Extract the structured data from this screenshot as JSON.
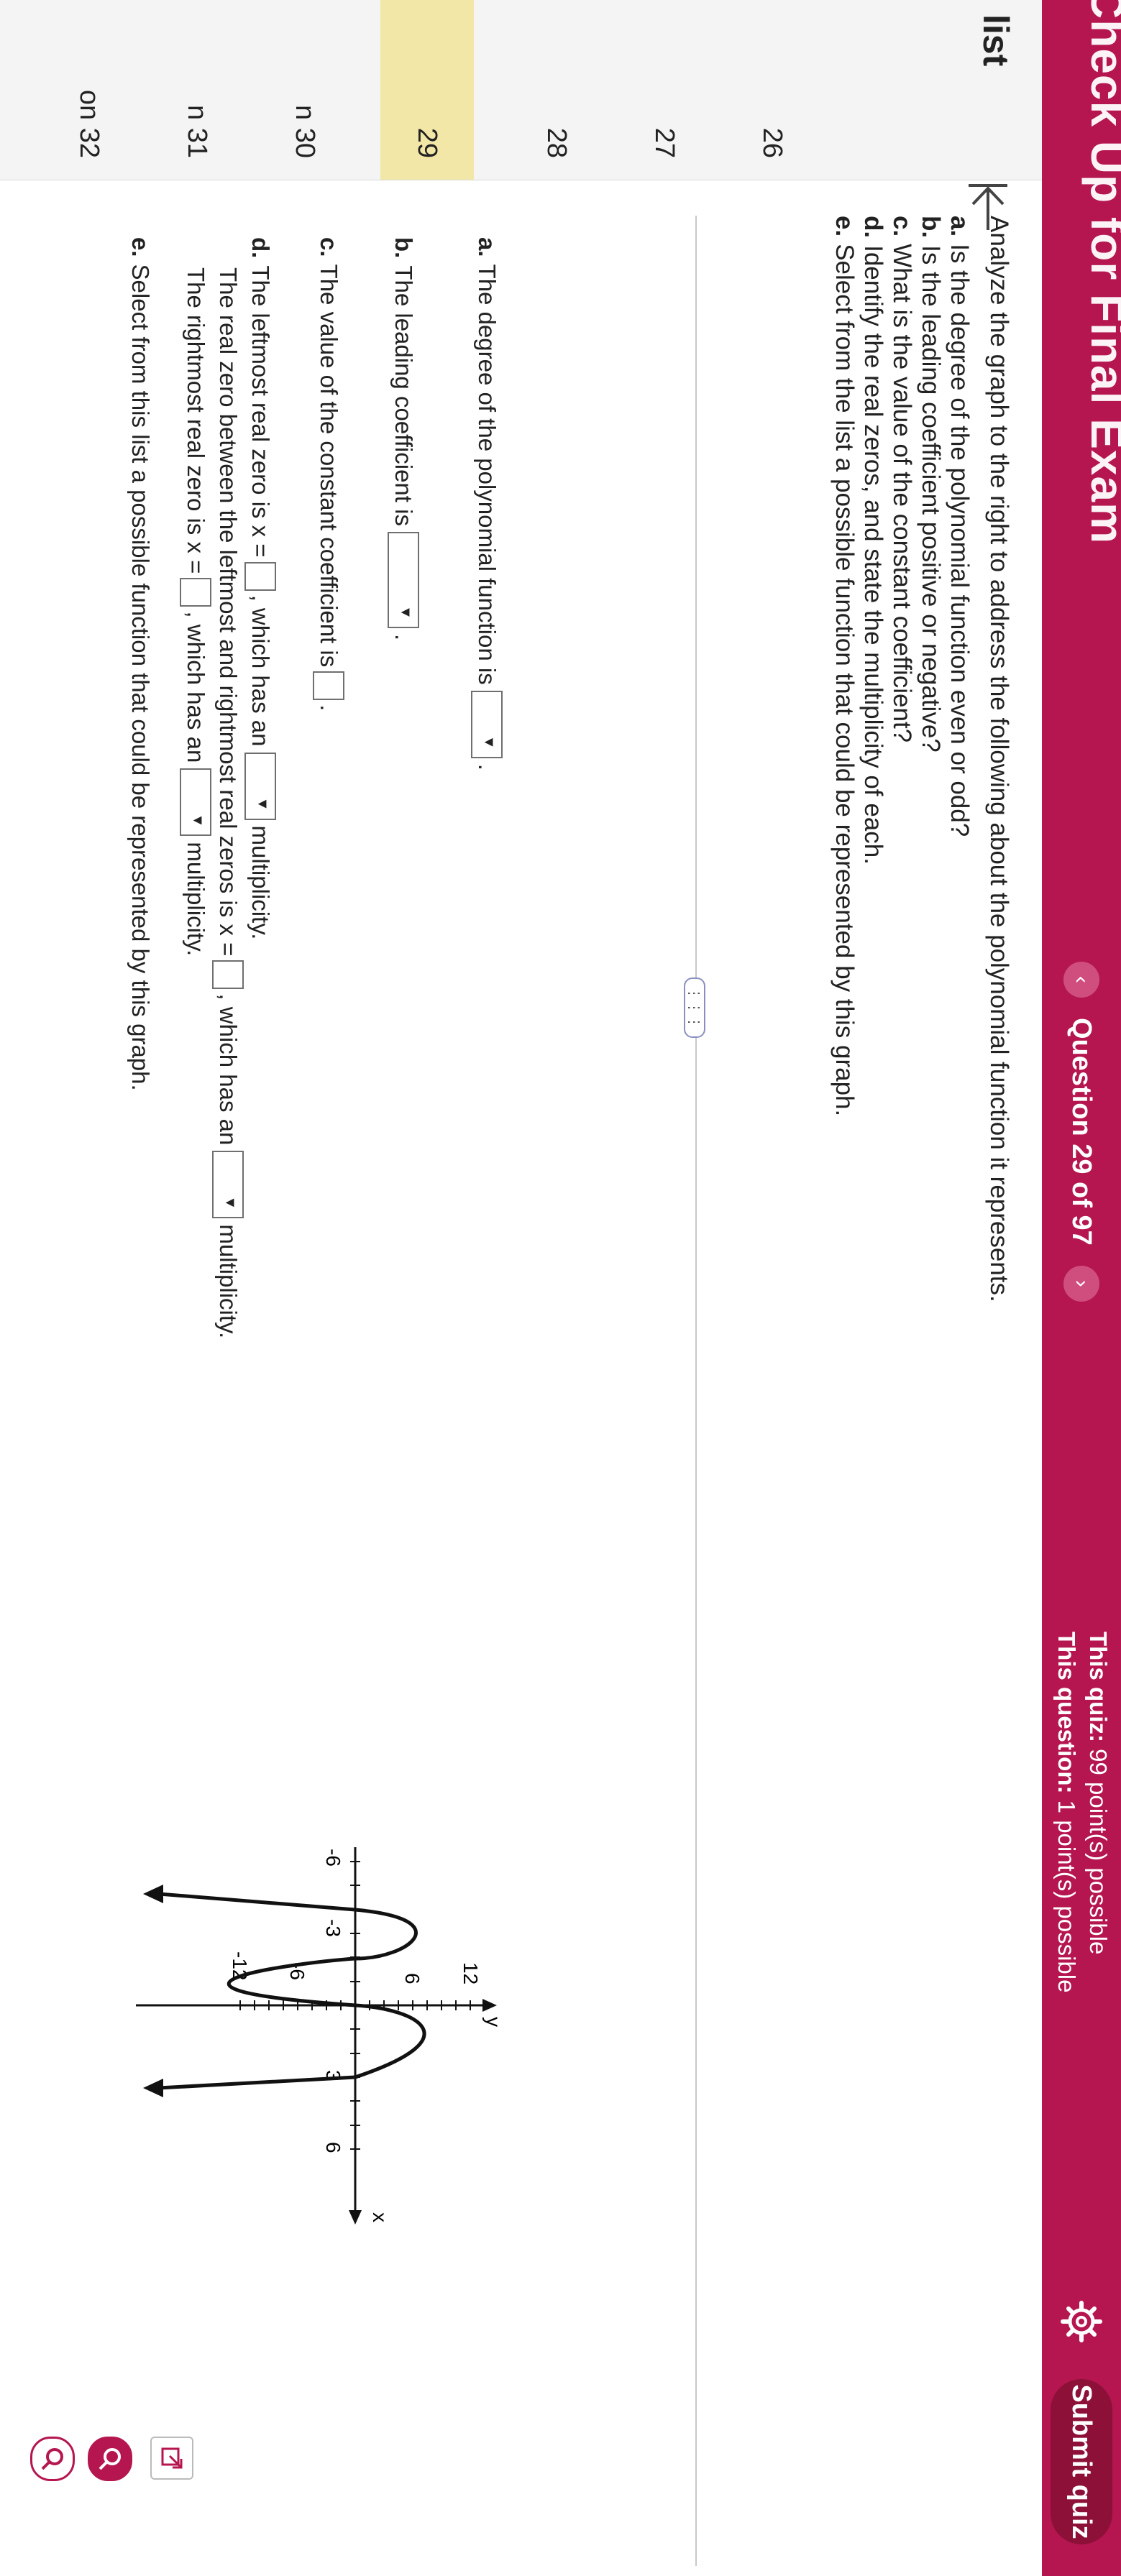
{
  "header": {
    "quiz_title": "Check Up for Final Exam",
    "question_label": "Question 29 of 97",
    "quiz_points_prefix": "This quiz:",
    "quiz_points": "99 point(s) possible",
    "question_points_prefix": "This question:",
    "question_points": "1 point(s) possible",
    "submit_label": "Submit quiz",
    "accent_color": "#b5164f"
  },
  "sidebar": {
    "title": "list",
    "items": [
      {
        "label": "26"
      },
      {
        "label": "27"
      },
      {
        "label": "28"
      },
      {
        "label": "29"
      },
      {
        "label": "n 30"
      },
      {
        "label": "n 31"
      },
      {
        "label": "on 32"
      }
    ],
    "active_index": 3
  },
  "question": {
    "intro": "Analyze the graph to the right to address the following about the polynomial function it represents.",
    "parts": [
      {
        "letter": "a.",
        "text": "Is the degree of the polynomial function even or odd?"
      },
      {
        "letter": "b.",
        "text": "Is the leading coefficient positive or negative?"
      },
      {
        "letter": "c.",
        "text": "What is the value of the constant coefficient?"
      },
      {
        "letter": "d.",
        "text": "Identify the real zeros, and state the multiplicity of each."
      },
      {
        "letter": "e.",
        "text": "Select from the list a possible function that could be represented by this graph."
      }
    ]
  },
  "answers": {
    "a": {
      "letter": "a.",
      "text": "The degree of the polynomial function is",
      "end": "."
    },
    "b": {
      "letter": "b.",
      "text": "The leading coefficient is",
      "end": "."
    },
    "c": {
      "letter": "c.",
      "text": "The value of the constant coefficient is",
      "end": "."
    },
    "d": {
      "letter": "d.",
      "line1_a": "The leftmost real zero is x =",
      "line1_b": ", which has an",
      "line1_c": "multiplicity.",
      "line2_a": "The real zero between the leftmost and rightmost real zeros is x =",
      "line2_b": ", which has an",
      "line2_c": "multiplicity.",
      "line3_a": "The rightmost real zero is x =",
      "line3_b": ", which has an",
      "line3_c": "multiplicity."
    },
    "e": {
      "letter": "e.",
      "text": "Select from this list a possible function that could be represented by this graph."
    }
  },
  "graph": {
    "x_label": "x",
    "y_label": "y",
    "x_ticks": [
      "-6",
      "-3",
      "3",
      "6"
    ],
    "y_ticks": [
      "12",
      "6",
      "-6",
      "-12"
    ]
  },
  "icons": [
    "back-arrow-icon",
    "gear-icon",
    "zoom-in-icon",
    "zoom-out-icon",
    "popout-icon"
  ]
}
